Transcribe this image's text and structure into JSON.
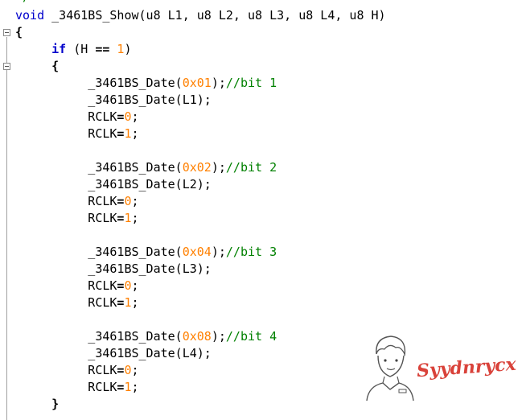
{
  "editor": {
    "top_comment": "*/",
    "lines": [
      {
        "y": 0,
        "html_key": "sig"
      },
      {
        "y": 1,
        "text": "{"
      },
      {
        "y": 2,
        "text": "if"
      },
      {
        "y": 3,
        "text": "{"
      }
    ],
    "signature": {
      "void": "void",
      "rest": " _3461BS_Show(u8 L1, u8 L2, u8 L3, u8 L4, u8 H)"
    },
    "open_brace": "{",
    "if_kw": "if",
    "if_open": " (H ",
    "if_op": "==",
    "if_num": "1",
    "if_close": ")",
    "inner_open": "{",
    "inner_close": "}",
    "blocks": [
      {
        "fn": "_3461BS_Date(",
        "hex": "0x01",
        "tail": ");",
        "comment": "//bit 1",
        "arg_line": "_3461BS_Date(L1);"
      },
      {
        "fn": "_3461BS_Date(",
        "hex": "0x02",
        "tail": ");",
        "comment": "//bit 2",
        "arg_line": "_3461BS_Date(L2);"
      },
      {
        "fn": "_3461BS_Date(",
        "hex": "0x04",
        "tail": ");",
        "comment": "//bit 3",
        "arg_line": "_3461BS_Date(L3);"
      },
      {
        "fn": "_3461BS_Date(",
        "hex": "0x08",
        "tail": ");",
        "comment": "//bit 4",
        "arg_line": "_3461BS_Date(L4);"
      }
    ],
    "rclk_name": "RCLK",
    "rclk_eq": "=",
    "rclk_low": "0",
    "rclk_high": "1",
    "semi": ";"
  },
  "watermark": {
    "text": "Syydnrycx"
  }
}
